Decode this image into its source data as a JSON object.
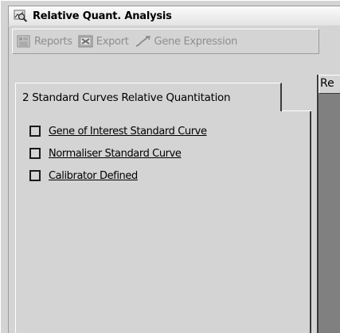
{
  "window": {
    "title": "Relative Quant. Analysis",
    "icon": "magnifier-chart-icon"
  },
  "toolbar": {
    "reports_label": "Reports",
    "export_label": "Export",
    "gene_expression_label": "Gene Expression",
    "disabled_color": "#8e8e8e"
  },
  "tab": {
    "label": "2 Standard Curves Relative Quantitation"
  },
  "options": [
    {
      "label": "Gene of Interest Standard Curve",
      "checked": false
    },
    {
      "label": "Normaliser Standard Curve",
      "checked": false
    },
    {
      "label": "Calibrator Defined",
      "checked": false
    }
  ],
  "right_panel": {
    "header": "Re"
  }
}
